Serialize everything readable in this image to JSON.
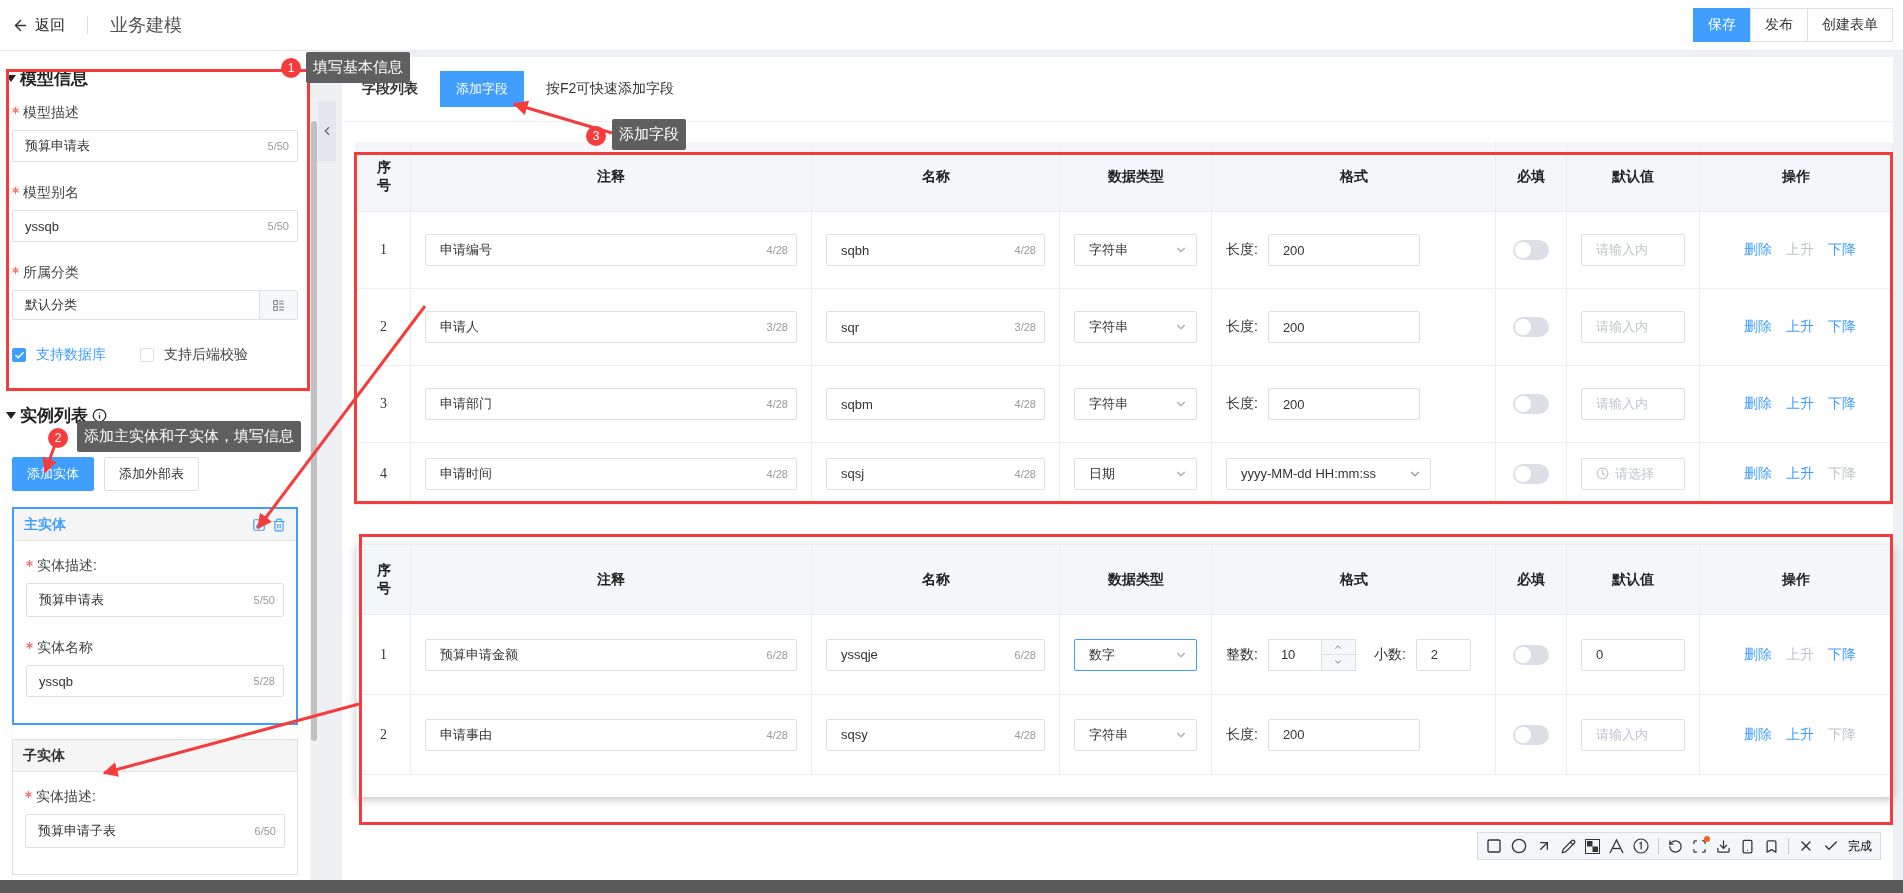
{
  "header": {
    "back": "返回",
    "title": "业务建模",
    "actions": [
      {
        "label": "保存",
        "primary": true
      },
      {
        "label": "发布",
        "primary": false
      },
      {
        "label": "创建表单",
        "primary": false
      }
    ]
  },
  "model_info": {
    "title": "模型信息",
    "fields": [
      {
        "kind": "text",
        "label": "模型描述",
        "required": true,
        "value": "预算申请表",
        "count": "5/50"
      },
      {
        "kind": "text",
        "label": "模型别名",
        "required": true,
        "value": "yssqb",
        "count": "5/50"
      },
      {
        "kind": "picker",
        "label": "所属分类",
        "required": true,
        "value": "默认分类"
      }
    ],
    "options": [
      {
        "label": "支持数据库",
        "checked": true
      },
      {
        "label": "支持后端校验",
        "checked": false
      }
    ]
  },
  "instances": {
    "title": "实例列表",
    "buttons": [
      {
        "label": "添加实体",
        "primary": true
      },
      {
        "label": "添加外部表",
        "primary": false
      }
    ],
    "entities": [
      {
        "title": "主实体",
        "selected": true,
        "fields": [
          {
            "label": "实体描述:",
            "required": true,
            "value": "预算申请表",
            "count": "5/50",
            "kind": "textarea"
          },
          {
            "label": "实体名称",
            "required": true,
            "value": "yssqb",
            "count": "5/28",
            "kind": "text"
          }
        ]
      },
      {
        "title": "子实体",
        "selected": false,
        "fields": [
          {
            "label": "实体描述:",
            "required": true,
            "value": "预算申请子表",
            "count": "6/50",
            "kind": "textarea"
          }
        ]
      }
    ]
  },
  "fields_panel": {
    "title": "字段列表",
    "add_button": "添加字段",
    "hint": "按F2可快速添加字段"
  },
  "tables": [
    {
      "columns": [
        "序号",
        "注释",
        "名称",
        "数据类型",
        "格式",
        "必填",
        "默认值",
        "操作"
      ],
      "rows": [
        {
          "index": "1",
          "comment": "申请编号",
          "comment_count": "4/28",
          "name": "sqbh",
          "name_count": "4/28",
          "type": "字符串",
          "focused": false,
          "format": {
            "kind": "length",
            "label": "长度:",
            "value": "200"
          },
          "required": false,
          "default": {
            "kind": "input",
            "placeholder": "请输入内"
          },
          "actions": [
            {
              "label": "删除",
              "disabled": false
            },
            {
              "label": "上升",
              "disabled": true
            },
            {
              "label": "下降",
              "disabled": false
            }
          ]
        },
        {
          "index": "2",
          "comment": "申请人",
          "comment_count": "3/28",
          "name": "sqr",
          "name_count": "3/28",
          "type": "字符串",
          "focused": false,
          "format": {
            "kind": "length",
            "label": "长度:",
            "value": "200"
          },
          "required": false,
          "default": {
            "kind": "input",
            "placeholder": "请输入内"
          },
          "actions": [
            {
              "label": "删除",
              "disabled": false
            },
            {
              "label": "上升",
              "disabled": false
            },
            {
              "label": "下降",
              "disabled": false
            }
          ]
        },
        {
          "index": "3",
          "comment": "申请部门",
          "comment_count": "4/28",
          "name": "sqbm",
          "name_count": "4/28",
          "type": "字符串",
          "focused": false,
          "format": {
            "kind": "length",
            "label": "长度:",
            "value": "200"
          },
          "required": false,
          "default": {
            "kind": "input",
            "placeholder": "请输入内"
          },
          "actions": [
            {
              "label": "删除",
              "disabled": false
            },
            {
              "label": "上升",
              "disabled": false
            },
            {
              "label": "下降",
              "disabled": false
            }
          ]
        },
        {
          "index": "4",
          "comment": "申请时间",
          "comment_count": "4/28",
          "name": "sqsj",
          "name_count": "4/28",
          "type": "日期",
          "focused": false,
          "format": {
            "kind": "datetime",
            "value": "yyyy-MM-dd HH:mm:ss"
          },
          "required": false,
          "default": {
            "kind": "time",
            "placeholder": "请选择"
          },
          "actions": [
            {
              "label": "删除",
              "disabled": false
            },
            {
              "label": "上升",
              "disabled": false
            },
            {
              "label": "下降",
              "disabled": true
            }
          ]
        }
      ]
    },
    {
      "columns": [
        "序号",
        "注释",
        "名称",
        "数据类型",
        "格式",
        "必填",
        "默认值",
        "操作"
      ],
      "rows": [
        {
          "index": "1",
          "comment": "预算申请金额",
          "comment_count": "6/28",
          "name": "yssqje",
          "name_count": "6/28",
          "type": "数字",
          "focused": true,
          "format": {
            "kind": "number",
            "int_label": "整数:",
            "int_value": "10",
            "dec_label": "小数:",
            "dec_value": "2"
          },
          "required": false,
          "default": {
            "kind": "input",
            "value": "0"
          },
          "actions": [
            {
              "label": "删除",
              "disabled": false
            },
            {
              "label": "上升",
              "disabled": true
            },
            {
              "label": "下降",
              "disabled": false
            }
          ]
        },
        {
          "index": "2",
          "comment": "申请事由",
          "comment_count": "4/28",
          "name": "sqsy",
          "name_count": "4/28",
          "type": "字符串",
          "focused": false,
          "format": {
            "kind": "length",
            "label": "长度:",
            "value": "200"
          },
          "required": false,
          "default": {
            "kind": "input",
            "placeholder": "请输入内"
          },
          "actions": [
            {
              "label": "删除",
              "disabled": false
            },
            {
              "label": "上升",
              "disabled": false
            },
            {
              "label": "下降",
              "disabled": true
            }
          ]
        }
      ]
    }
  ],
  "callouts": [
    {
      "number": "1",
      "text": "填写基本信息"
    },
    {
      "number": "2",
      "text": "添加主实体和子实体，填写信息"
    },
    {
      "number": "3",
      "text": "添加字段"
    }
  ],
  "capture_toolbar": {
    "done": "完成"
  }
}
